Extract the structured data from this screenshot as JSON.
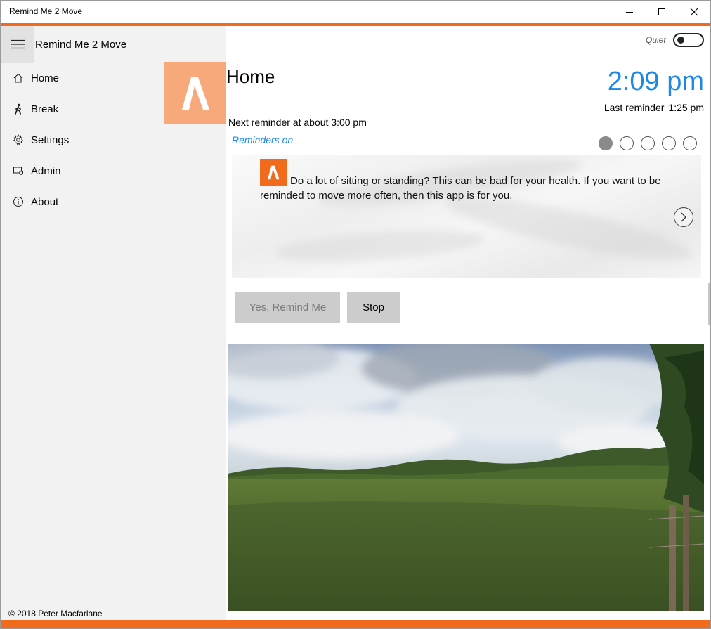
{
  "window": {
    "title": "Remind Me 2 Move"
  },
  "sidebar": {
    "app_name": "Remind Me 2 Move",
    "items": [
      {
        "label": "Home",
        "icon": "home-icon"
      },
      {
        "label": "Break",
        "icon": "walking-person-icon"
      },
      {
        "label": "Settings",
        "icon": "gear-icon"
      },
      {
        "label": "Admin",
        "icon": "admin-icon"
      },
      {
        "label": "About",
        "icon": "info-icon"
      }
    ],
    "copyright": "© 2018 Peter Macfarlane"
  },
  "header": {
    "quiet_label": "Quiet",
    "quiet_on": false
  },
  "main": {
    "page_title": "Home",
    "clock": "2:09 pm",
    "last_reminder_label": "Last reminder",
    "last_reminder_time": "1:25 pm",
    "next_reminder": "Next reminder at about 3:00 pm",
    "reminders_status": "Reminders on",
    "carousel": {
      "total": 5,
      "active_index": 0,
      "text": "Do a lot of sitting or standing? This can be bad for your health. If you want to be reminded to move more often, then this app is for you."
    },
    "buttons": {
      "yes": "Yes, Remind Me",
      "stop": "Stop"
    }
  },
  "colors": {
    "accent": "#f26b1d",
    "logo_tile": "#f7a97c",
    "link": "#1e88e5"
  }
}
